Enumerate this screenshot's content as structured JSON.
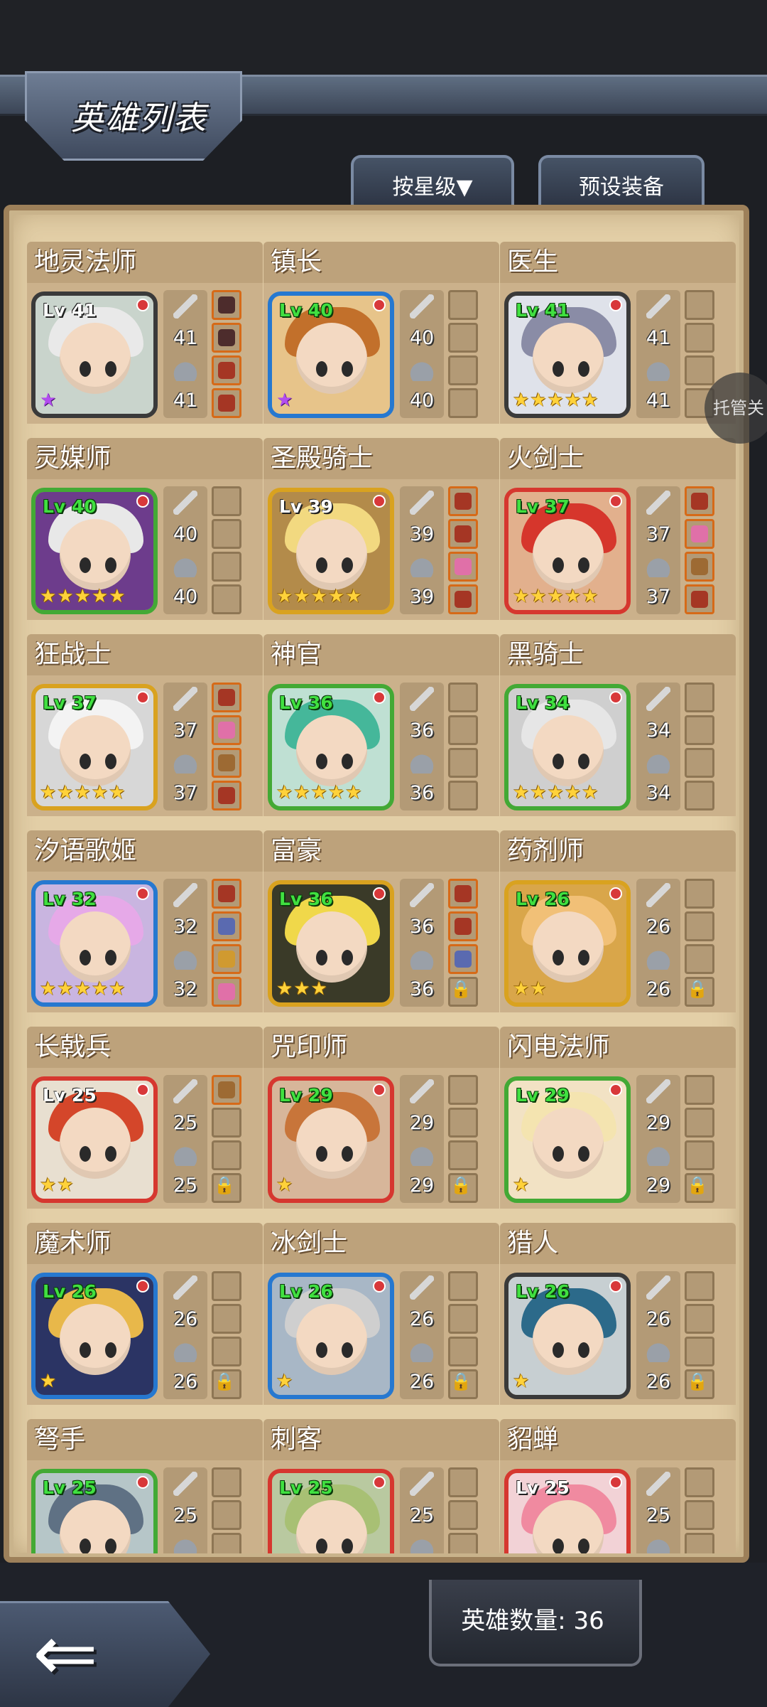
{
  "header": {
    "title": "英雄列表",
    "sort_label": "按星级▼",
    "preset_label": "预设装备"
  },
  "floating": {
    "trustee_label": "托管关"
  },
  "footer": {
    "hero_count_label": "英雄数量: 36"
  },
  "colors": {
    "panel": "#e3cfa7",
    "level_green": "#40e040",
    "star_gold": "#ffd23a"
  },
  "heroes": [
    {
      "name": "地灵法师",
      "level": "Lv 41",
      "level_color": "white",
      "frame": "#3a3a3a",
      "bg": "#c9d4cc",
      "hair": "#e9e9e9",
      "stars": 1,
      "star_type": "purple",
      "atk": "41",
      "def": "41",
      "slots": [
        "dark",
        "dark",
        "red",
        "red"
      ]
    },
    {
      "name": "镇长",
      "level": "Lv 40",
      "level_color": "green",
      "frame": "#2678d0",
      "bg": "#e7c48a",
      "hair": "#c2702b",
      "stars": 1,
      "star_type": "purple",
      "atk": "40",
      "def": "40",
      "slots": [
        "empty",
        "empty",
        "empty",
        "empty"
      ]
    },
    {
      "name": "医生",
      "level": "Lv 41",
      "level_color": "green",
      "frame": "#3a3a3a",
      "bg": "#dfe2ea",
      "hair": "#8a8ca6",
      "stars": 5,
      "star_type": "gold",
      "atk": "41",
      "def": "41",
      "slots": [
        "empty",
        "empty",
        "empty",
        "empty"
      ]
    },
    {
      "name": "灵媒师",
      "level": "Lv 40",
      "level_color": "green",
      "frame": "#43a935",
      "bg": "#6d3c8c",
      "hair": "#e8e8e8",
      "stars": 5,
      "star_type": "gold",
      "atk": "40",
      "def": "40",
      "slots": [
        "empty",
        "empty",
        "empty",
        "empty"
      ]
    },
    {
      "name": "圣殿骑士",
      "level": "Lv 39",
      "level_color": "white",
      "frame": "#d9a21f",
      "bg": "#b38b4a",
      "hair": "#f2d980",
      "stars": 5,
      "star_type": "gold",
      "atk": "39",
      "def": "39",
      "slots": [
        "red",
        "red",
        "pink",
        "red"
      ]
    },
    {
      "name": "火剑士",
      "level": "Lv 37",
      "level_color": "green",
      "frame": "#d6372f",
      "bg": "#e2b08d",
      "hair": "#d6362c",
      "stars": 5,
      "star_type": "gold",
      "atk": "37",
      "def": "37",
      "slots": [
        "red",
        "pink",
        "brown",
        "red"
      ]
    },
    {
      "name": "狂战士",
      "level": "Lv 37",
      "level_color": "green",
      "frame": "#d9a21f",
      "bg": "#d7d7d7",
      "hair": "#f3f3f3",
      "stars": 5,
      "star_type": "gold",
      "atk": "37",
      "def": "37",
      "slots": [
        "red",
        "pink",
        "brown",
        "red"
      ]
    },
    {
      "name": "神官",
      "level": "Lv 36",
      "level_color": "green",
      "frame": "#43a935",
      "bg": "#bfe0d3",
      "hair": "#45b79a",
      "stars": 5,
      "star_type": "gold",
      "atk": "36",
      "def": "36",
      "slots": [
        "empty",
        "empty",
        "empty",
        "empty"
      ]
    },
    {
      "name": "黑骑士",
      "level": "Lv 34",
      "level_color": "green",
      "frame": "#43a935",
      "bg": "#cfcfcf",
      "hair": "#e6e6e6",
      "stars": 5,
      "star_type": "gold",
      "atk": "34",
      "def": "34",
      "slots": [
        "empty",
        "empty",
        "empty",
        "empty"
      ]
    },
    {
      "name": "汐语歌姬",
      "level": "Lv 32",
      "level_color": "green",
      "frame": "#2678d0",
      "bg": "#c9b5e0",
      "hair": "#e6a9e8",
      "stars": 5,
      "star_type": "gold",
      "atk": "32",
      "def": "32",
      "slots": [
        "red",
        "blue",
        "gold",
        "pink"
      ]
    },
    {
      "name": "富豪",
      "level": "Lv 36",
      "level_color": "green",
      "frame": "#d9a21f",
      "bg": "#3a3a28",
      "hair": "#f0d84a",
      "stars": 3,
      "star_type": "gold",
      "atk": "36",
      "def": "36",
      "slots": [
        "red",
        "red",
        "blue",
        "lock"
      ]
    },
    {
      "name": "药剂师",
      "level": "Lv 26",
      "level_color": "green",
      "frame": "#d9a21f",
      "bg": "#d9a64a",
      "hair": "#f1c077",
      "stars": 2,
      "star_type": "gold",
      "atk": "26",
      "def": "26",
      "slots": [
        "empty",
        "empty",
        "empty",
        "lock"
      ]
    },
    {
      "name": "长戟兵",
      "level": "Lv 25",
      "level_color": "white",
      "frame": "#d6372f",
      "bg": "#e8dfd0",
      "hair": "#d4462a",
      "stars": 2,
      "star_type": "gold",
      "atk": "25",
      "def": "25",
      "slots": [
        "brown",
        "empty",
        "empty",
        "lock"
      ]
    },
    {
      "name": "咒印师",
      "level": "Lv 29",
      "level_color": "green",
      "frame": "#d6372f",
      "bg": "#d7b69a",
      "hair": "#c8753a",
      "stars": 1,
      "star_type": "gold",
      "atk": "29",
      "def": "29",
      "slots": [
        "empty",
        "empty",
        "empty",
        "lock"
      ]
    },
    {
      "name": "闪电法师",
      "level": "Lv 29",
      "level_color": "green",
      "frame": "#43a935",
      "bg": "#f2e2c4",
      "hair": "#f4e4b0",
      "stars": 1,
      "star_type": "gold",
      "atk": "29",
      "def": "29",
      "slots": [
        "empty",
        "empty",
        "empty",
        "lock"
      ]
    },
    {
      "name": "魔术师",
      "level": "Lv 26",
      "level_color": "green",
      "frame": "#2678d0",
      "bg": "#2b3464",
      "hair": "#e8b84a",
      "stars": 1,
      "star_type": "gold",
      "atk": "26",
      "def": "26",
      "slots": [
        "empty",
        "empty",
        "empty",
        "lock"
      ]
    },
    {
      "name": "冰剑士",
      "level": "Lv 26",
      "level_color": "green",
      "frame": "#2678d0",
      "bg": "#a8b7c6",
      "hair": "#cfcfcf",
      "stars": 1,
      "star_type": "gold",
      "atk": "26",
      "def": "26",
      "slots": [
        "empty",
        "empty",
        "empty",
        "lock"
      ]
    },
    {
      "name": "猎人",
      "level": "Lv 26",
      "level_color": "green",
      "frame": "#3a3a3a",
      "bg": "#c7cfd2",
      "hair": "#2c6a8a",
      "stars": 1,
      "star_type": "gold",
      "atk": "26",
      "def": "26",
      "slots": [
        "empty",
        "empty",
        "empty",
        "lock"
      ]
    },
    {
      "name": "弩手",
      "level": "Lv 25",
      "level_color": "green",
      "frame": "#43a935",
      "bg": "#b6c6c8",
      "hair": "#5f7184",
      "stars": 0,
      "star_type": "gold",
      "atk": "25",
      "def": "",
      "slots": [
        "empty",
        "empty",
        "empty",
        "empty"
      ]
    },
    {
      "name": "刺客",
      "level": "Lv 25",
      "level_color": "green",
      "frame": "#d6372f",
      "bg": "#b9c9a0",
      "hair": "#a8c074",
      "stars": 0,
      "star_type": "gold",
      "atk": "25",
      "def": "",
      "slots": [
        "empty",
        "empty",
        "empty",
        "empty"
      ]
    },
    {
      "name": "貂蝉",
      "level": "Lv 25",
      "level_color": "white",
      "frame": "#d6372f",
      "bg": "#f2d2d6",
      "hair": "#f08aa0",
      "stars": 0,
      "star_type": "gold",
      "atk": "25",
      "def": "",
      "slots": [
        "empty",
        "empty",
        "empty",
        "empty"
      ]
    }
  ]
}
